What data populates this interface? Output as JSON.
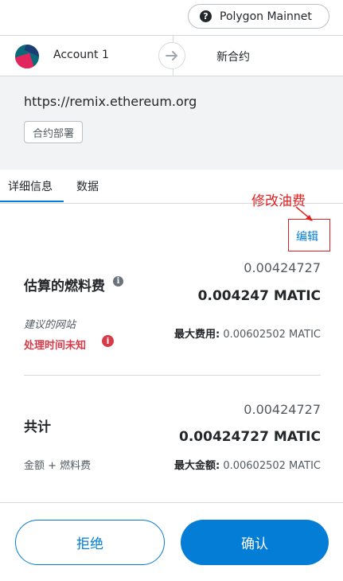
{
  "network": {
    "label": "Polygon Mainnet",
    "icon": "question-icon"
  },
  "account": {
    "name": "Account 1"
  },
  "transaction": {
    "title": "新合约"
  },
  "origin": {
    "url": "https://remix.ethereum.org",
    "tag": "合约部署"
  },
  "tabs": [
    {
      "label": "详细信息",
      "active": true
    },
    {
      "label": "数据",
      "active": false
    }
  ],
  "annotation": {
    "label": "修改油费",
    "color": "#e02020"
  },
  "edit_label": "编辑",
  "gas": {
    "title": "估算的燃料费",
    "fee_secondary": "0.00424727",
    "fee_primary": "0.004247 MATIC",
    "suggested": "建议的网站",
    "processing": "处理时间未知",
    "max_label": "最大费用:",
    "max_value": "0.00602502 MATIC"
  },
  "total": {
    "title": "共计",
    "secondary": "0.00424727",
    "primary": "0.00424727 MATIC",
    "subtitle": "金额 + 燃料费",
    "max_label": "最大金额:",
    "max_value": "0.00602502 MATIC"
  },
  "buttons": {
    "reject": "拒绝",
    "confirm": "确认"
  },
  "colors": {
    "accent": "#037dd6",
    "error": "#d73a49"
  }
}
